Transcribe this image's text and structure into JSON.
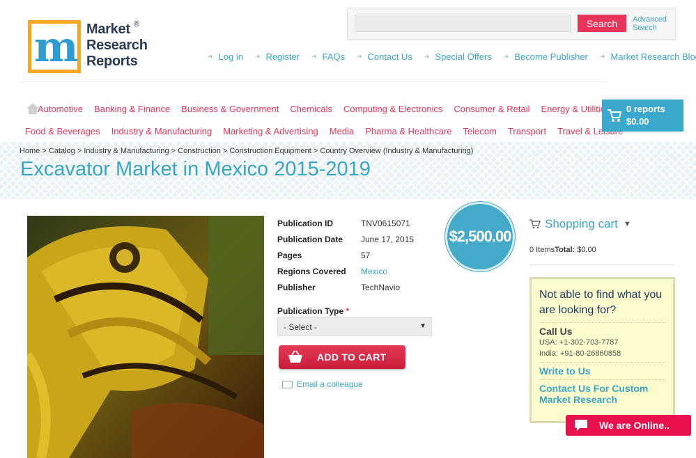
{
  "header": {
    "logo": {
      "line1": "Market",
      "line2": "Research",
      "line3": "Reports",
      "reg": "®"
    },
    "search": {
      "placeholder": "",
      "button": "Search",
      "advanced_line1": "Advanced",
      "advanced_line2": "Search"
    },
    "top_links": [
      "Log in",
      "Register",
      "FAQs",
      "Contact Us",
      "Special Offers",
      "Become Publisher",
      "Market Research Blog"
    ]
  },
  "categories": {
    "row1": [
      "Automotive",
      "Banking & Finance",
      "Business & Government",
      "Chemicals",
      "Computing & Electronics",
      "Consumer & Retail",
      "Energy & Utilities"
    ],
    "row2": [
      "Food & Beverages",
      "Industry & Manufacturing",
      "Marketing & Advertising",
      "Media",
      "Pharma & Healthcare",
      "Telecom",
      "Transport",
      "Travel & Leisure"
    ]
  },
  "cart": {
    "count": "0 reports",
    "total": "$0.00"
  },
  "breadcrumb": "Home > Catalog > Industry & Manufacturing > Construction > Construction Equipment > Country Overview (Industry & Manufacturing)",
  "title": "Excavator Market in Mexico 2015-2019",
  "details": [
    {
      "label": "Publication ID",
      "value": "TNV0615071"
    },
    {
      "label": "Publication Date",
      "value": "June 17, 2015"
    },
    {
      "label": "Pages",
      "value": "57"
    },
    {
      "label": "Regions Covered",
      "value": "Mexico"
    },
    {
      "label": "Publisher",
      "value": "TechNavio"
    }
  ],
  "price": "$2,500.00",
  "pub_type": {
    "label": "Publication Type",
    "required": "*",
    "selected": "- Select -"
  },
  "add_to_cart": "ADD TO CART",
  "email_colleague": "Email a colleague",
  "shopping_cart": {
    "title": "Shopping cart",
    "items": "0 Items",
    "total_label": "Total:",
    "total": "$0.00"
  },
  "help": {
    "title": "Not able to find what you are looking for?",
    "call_us": "Call Us",
    "usa": "USA: +1-302-703-7787",
    "india": "India: +91-80-26860858",
    "write": "Write to Us",
    "custom": "Contact Us For Custom Market Research"
  },
  "chat": "We are Online..",
  "colors": {
    "accent": "#3aa6c7",
    "pink": "#e8345a",
    "chat": "#e8114d"
  }
}
